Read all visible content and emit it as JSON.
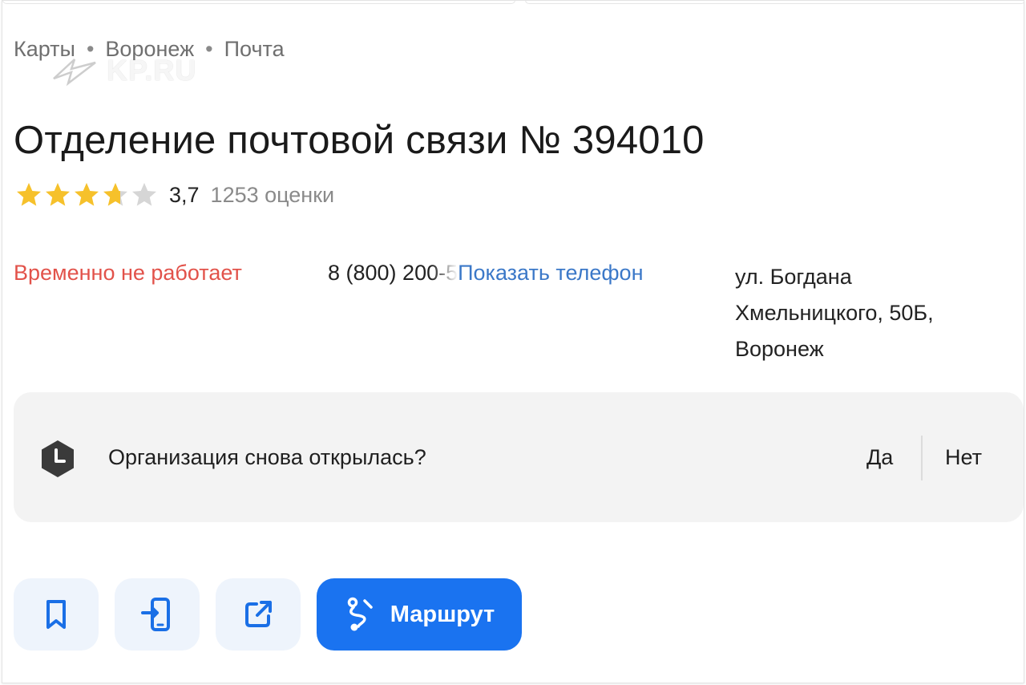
{
  "breadcrumb": {
    "items": [
      "Карты",
      "Воронеж",
      "Почта"
    ],
    "separator": "•"
  },
  "watermark": {
    "text": "KP.RU"
  },
  "place": {
    "title": "Отделение почтовой связи № 394010",
    "rating_value": "3,7",
    "rating_stars": 3.7,
    "rating_count": "1253 оценки",
    "status": "Временно не работает",
    "phone_partial": "8 (800) 200-5",
    "show_phone_label": "Показать телефон",
    "address_lines": [
      "ул. Богдана",
      "Хмельницкого, 50Б,",
      "Воронеж"
    ]
  },
  "question": {
    "text": "Организация снова открылась?",
    "yes_label": "Да",
    "no_label": "Нет",
    "icon": "clock-icon"
  },
  "actions": {
    "bookmark_icon": "bookmark-icon",
    "send_to_phone_icon": "send-to-phone-icon",
    "share_icon": "share-icon",
    "route_label": "Маршрут",
    "route_icon": "route-icon"
  },
  "colors": {
    "status": "#e2524a",
    "link": "#3b78c8",
    "route_button": "#1a73f0",
    "icon_button_bg": "#eef4fc",
    "star_filled": "#f6c12b",
    "star_empty": "#d6d6d6"
  }
}
